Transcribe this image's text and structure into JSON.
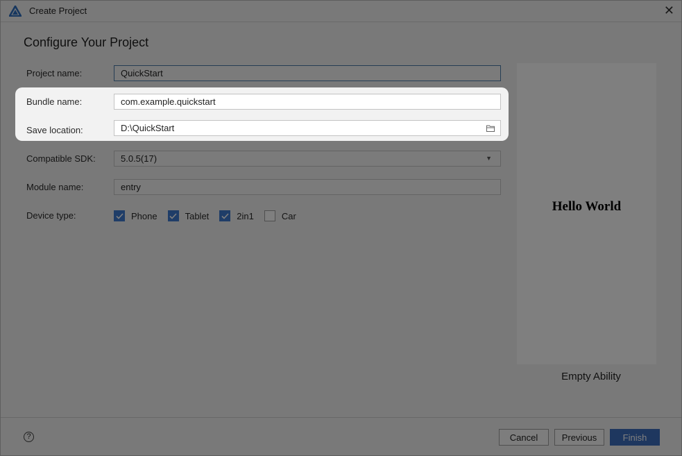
{
  "window": {
    "title": "Create Project"
  },
  "page": {
    "heading": "Configure Your Project"
  },
  "form": {
    "project_name": {
      "label": "Project name:",
      "value": "QuickStart"
    },
    "bundle_name": {
      "label": "Bundle name:",
      "value": "com.example.quickstart"
    },
    "save_location": {
      "label": "Save location:",
      "value": "D:\\QuickStart"
    },
    "compatible_sdk": {
      "label": "Compatible SDK:",
      "value": "5.0.5(17)"
    },
    "module_name": {
      "label": "Module name:",
      "value": "entry"
    },
    "device_type": {
      "label": "Device type:",
      "options": [
        {
          "label": "Phone",
          "checked": true
        },
        {
          "label": "Tablet",
          "checked": true
        },
        {
          "label": "2in1",
          "checked": true
        },
        {
          "label": "Car",
          "checked": false
        }
      ]
    }
  },
  "preview": {
    "text": "Hello World",
    "template_name": "Empty Ability"
  },
  "footer": {
    "help_symbol": "?",
    "cancel_label": "Cancel",
    "previous_label": "Previous",
    "finish_label": "Finish"
  },
  "colors": {
    "accent": "#3e7ad0",
    "finish_button": "#3d6fbe",
    "focus_border": "#4a7aa8"
  }
}
